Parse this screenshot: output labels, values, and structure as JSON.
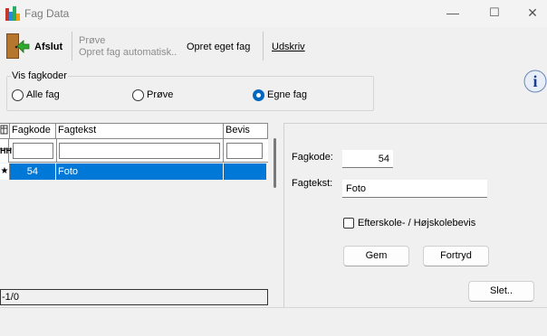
{
  "window": {
    "title": "Fag Data",
    "minimize": "—",
    "maximize": "☐",
    "close": "✕"
  },
  "toolbar": {
    "exit_label": "Afslut",
    "test_label": "Prøve",
    "create_auto_label": "Opret fag automatisk..",
    "create_own_label": "Opret eget fag",
    "print_label": "Udskriv"
  },
  "filter_group": {
    "legend": "Vis fagkoder",
    "options": [
      {
        "label": "Alle fag",
        "checked": false
      },
      {
        "label": "Prøve",
        "checked": false
      },
      {
        "label": "Egne fag",
        "checked": true
      }
    ]
  },
  "grid": {
    "columns": [
      "Fagkode",
      "Fagtekst",
      "Bevis"
    ],
    "filter_row_marker": "ĦĦ",
    "rows": [
      {
        "marker": "★",
        "fagkode": "54",
        "fagtekst": "Foto",
        "bevis": ""
      }
    ],
    "footer": "-1/0"
  },
  "detail": {
    "fagkode_label": "Fagkode:",
    "fagkode_value": "54",
    "fagtekst_label": "Fagtekst:",
    "fagtekst_value": "Foto",
    "checkbox_label": "Efterskole- / Højskolebevis",
    "checkbox_checked": false,
    "save_button": "Gem",
    "cancel_button": "Fortryd",
    "delete_button": "Slet.."
  },
  "colors": {
    "selection": "#0078d7",
    "radio_checked": "#0067c0"
  }
}
